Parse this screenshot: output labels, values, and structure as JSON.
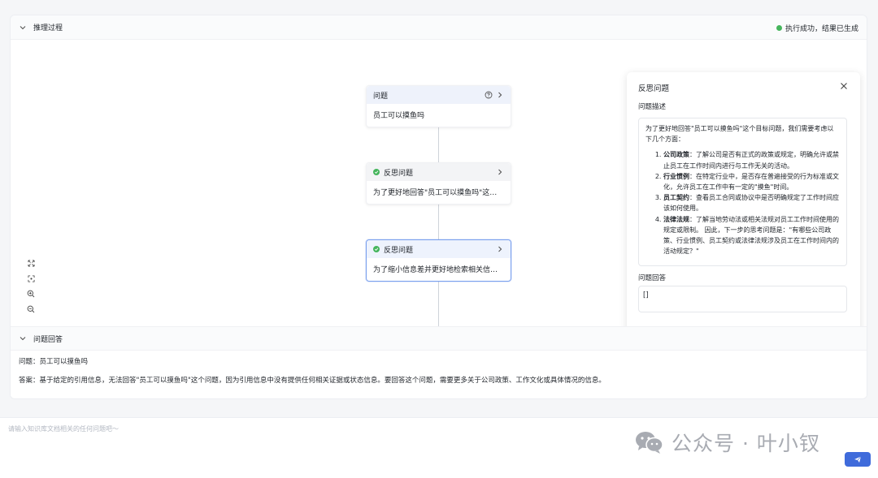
{
  "reasoning": {
    "title": "推理过程",
    "status": "执行成功，结果已生成"
  },
  "nodes": [
    {
      "label": "问题",
      "body": "员工可以摸鱼吗"
    },
    {
      "label": "反思问题",
      "body": "为了更好地回答\"员工可以摸鱼吗\"这个目..."
    },
    {
      "label": "反思问题",
      "body": "为了缩小信息差并更好地检索相关信息，..."
    }
  ],
  "panel": {
    "title": "反思问题",
    "desc_label": "问题描述",
    "desc_intro": "为了更好地回答\"员工可以摸鱼吗\"这个目标问题，我们需要考虑以下几个方面：",
    "items": [
      {
        "term": "公司政策",
        "text": "：了解公司是否有正式的政策或规定，明确允许或禁止员工在工作时间内进行与工作无关的活动。"
      },
      {
        "term": "行业惯例",
        "text": "：在特定行业中，是否存在普遍接受的行为标准或文化，允许员工在工作中有一定的\"摸鱼\"时间。"
      },
      {
        "term": "员工契约",
        "text": "：查看员工合同或协议中是否明确规定了工作时间应该如何使用。"
      },
      {
        "term": "法律法规",
        "text": "：了解当地劳动法或相关法规对员工工作时间使用的规定或限制。 因此，下一步的思考问题是：\"有哪些公司政策、行业惯例、员工契约或法律法规涉及员工在工作时间内的活动规定？\""
      }
    ],
    "answer_label": "问题回答",
    "answer_value": "[]"
  },
  "answer_section": {
    "title": "问题回答",
    "question": "问题：员工可以摸鱼吗",
    "answer": "答案：基于给定的引用信息，无法回答\"员工可以摸鱼吗\"这个问题，因为引用信息中没有提供任何相关证据或状态信息。要回答这个问题，需要更多关于公司政策、工作文化或具体情况的信息。"
  },
  "input": {
    "placeholder": "请输入知识库文档相关的任何问题吧～"
  },
  "watermark": {
    "text": "公众号 · 叶小钗"
  },
  "colors": {
    "success": "#45b55c",
    "accent": "#3f6bdb",
    "selected_border": "#7aa0ee"
  },
  "icons": {
    "header_toggle": "chevron-down-icon",
    "help": "question-circle-icon",
    "expand": "chevron-right-icon",
    "close": "close-icon",
    "send": "paper-plane-icon",
    "watermark": "wechat-icon"
  }
}
